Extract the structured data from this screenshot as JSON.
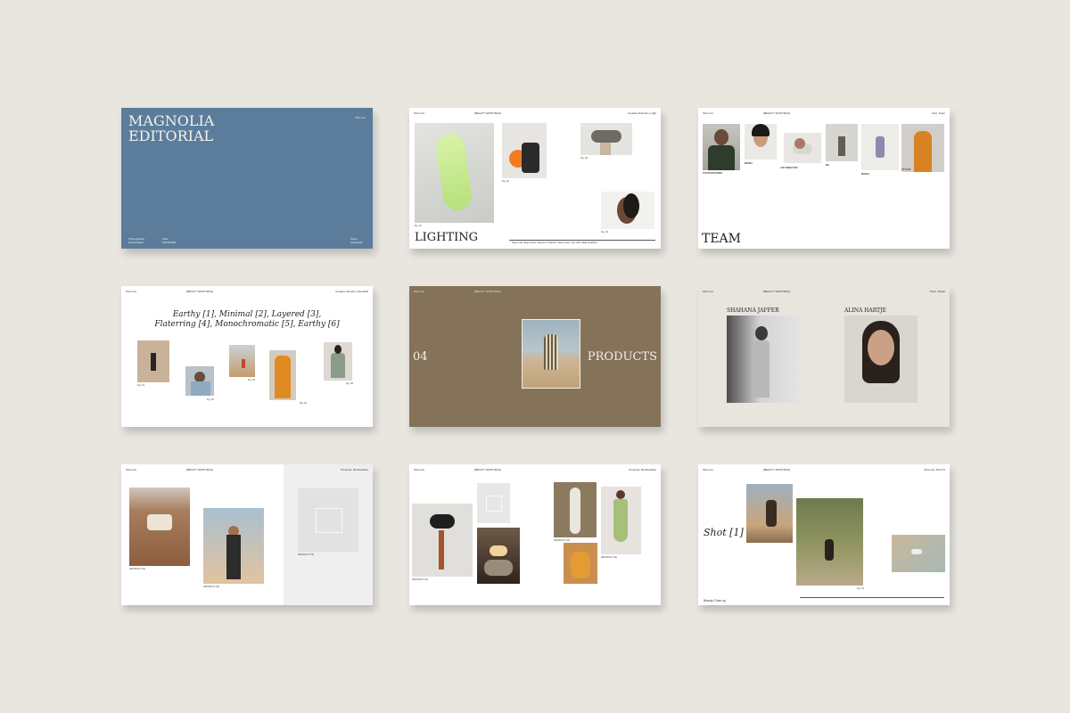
{
  "slides": {
    "cover": {
      "title_line1": "MAGNOLIA",
      "title_line2": "EDITORIAL",
      "top_right": "Shot List",
      "photographer_label": "Photographer",
      "photographer_name": "Nicole Baker",
      "date_label": "Date",
      "date_value": "23/10/2025",
      "client_label": "Client",
      "client_value": "Ottograph",
      "bg_color": "#5b7d9b"
    },
    "lighting": {
      "header_left": "Shot List",
      "header_center": "[BEAUTY EDITORIAL]",
      "header_right": "Creative Direction, Light",
      "title": "LIGHTING",
      "fig1": "Fig. 01",
      "fig2": "Fig. 02",
      "fig3": "Fig. 03",
      "fig4": "Fig. 04",
      "footnote": "Super soft, large source, almost no shadow. Clean forms, soft, with subtle shadows."
    },
    "team": {
      "header_left": "Shot List",
      "header_center": "[BEAUTY EDITORIAL]",
      "header_right": "Intro, Team",
      "title": "TEAM",
      "roles": [
        "PHOTOGRAPHER",
        "MODEL",
        "ART DIRECTOR",
        "MU",
        "MODEL",
        "STYLIST"
      ]
    },
    "moodwords": {
      "header_left": "Shot List",
      "header_center": "[BEAUTY EDITORIAL]",
      "header_right": "Creative direction, Moodstill",
      "line1": "Earthy [1], Minimal [2], Layered [3],",
      "line2": "Flaterring [4], Monochromatic [5], Earthy [6]",
      "figs": [
        "Fig. 01",
        "Fig. 02",
        "Fig. 03",
        "Fig. 04",
        "Fig. 05"
      ]
    },
    "products": {
      "header_left": "Shot List",
      "header_center": "[BEAUTY EDITORIAL]",
      "number": "04",
      "title": "PRODUCTS",
      "bg_color": "#857359"
    },
    "models": {
      "header_left": "Shot List",
      "header_center": "[BEAUTY EDITORIAL]",
      "header_right": "Team, Model",
      "model1": "SHAHANA JAFFER",
      "model2": "ALINA HARTJE",
      "bg_color": "#e8e5df"
    },
    "merch1": {
      "header_left": "Shot List",
      "header_center": "[BEAUTY EDITORIAL]",
      "header_right": "Products, Merchandise",
      "labels": [
        "[PRODUCT 01]",
        "[PRODUCT 02]",
        "[PRODUCT 03]"
      ]
    },
    "merch2": {
      "header_left": "Shot List",
      "header_center": "[BEAUTY EDITORIAL]",
      "header_right": "Products, Merchandise",
      "labels": [
        "[PRODUCT 01]",
        "[PRODUCT 02]",
        "[PRODUCT 03]"
      ]
    },
    "shot": {
      "header_left": "Shot List",
      "header_center": "[BEAUTY EDITORIAL]",
      "header_right": "Shot List, Shot 01",
      "title": "Shot [1]",
      "bottom_left": "Beauty Close up",
      "fig": "Fig. 01"
    }
  }
}
